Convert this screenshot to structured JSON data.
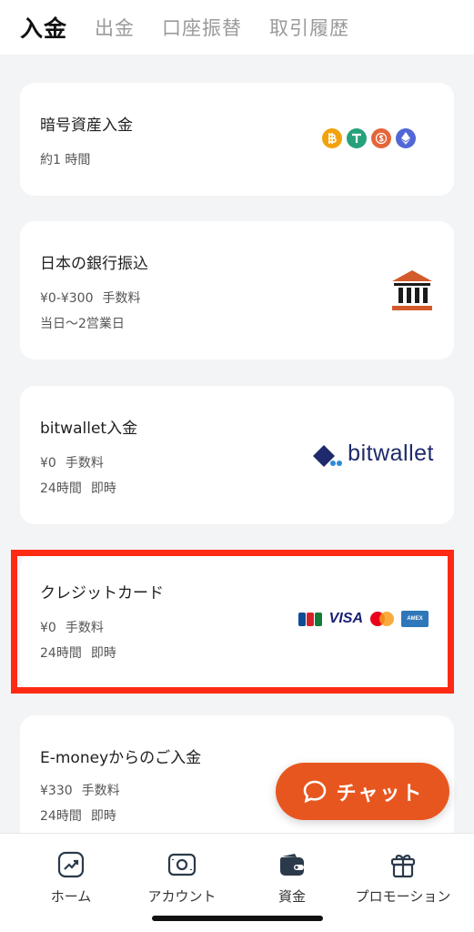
{
  "tabs": [
    {
      "label": "入金",
      "active": true
    },
    {
      "label": "出金",
      "active": false
    },
    {
      "label": "口座振替",
      "active": false
    },
    {
      "label": "取引履歴",
      "active": false
    }
  ],
  "methods": [
    {
      "title": "暗号資産入金",
      "lines": [
        [
          "約1 時間"
        ]
      ],
      "icon": "crypto-coins-icon"
    },
    {
      "title": "日本の銀行振込",
      "lines": [
        [
          "¥0-¥300",
          "手数料"
        ],
        [
          "当日～2営業日"
        ]
      ],
      "icon": "bank-icon"
    },
    {
      "title": "bitwallet入金",
      "lines": [
        [
          "¥0",
          "手数料"
        ],
        [
          "24時間",
          "即時"
        ]
      ],
      "icon": "bitwallet-logo",
      "logo_text": "bitwallet"
    },
    {
      "title": "クレジットカード",
      "lines": [
        [
          "¥0",
          "手数料"
        ],
        [
          "24時間",
          "即時"
        ]
      ],
      "icon": "credit-cards-icon",
      "card_brands": [
        "JCB",
        "VISA",
        "Mastercard",
        "AMEX"
      ],
      "visa_text": "VISA",
      "amex_text": "AMEX"
    },
    {
      "title": "E-moneyからのご入金",
      "lines": [
        [
          "¥330",
          "手数料"
        ],
        [
          "24時間",
          "即時"
        ]
      ]
    }
  ],
  "chat_button": {
    "label": "チャット"
  },
  "bottom_nav": [
    {
      "label": "ホーム",
      "icon": "home-chart-icon"
    },
    {
      "label": "アカウント",
      "icon": "account-cash-icon"
    },
    {
      "label": "資金",
      "icon": "wallet-icon",
      "active": true
    },
    {
      "label": "プロモーション",
      "icon": "gift-icon"
    }
  ],
  "colors": {
    "accent": "#e8561f",
    "highlight_border": "#ff2a14",
    "bitwallet_blue": "#1e2a6b"
  }
}
